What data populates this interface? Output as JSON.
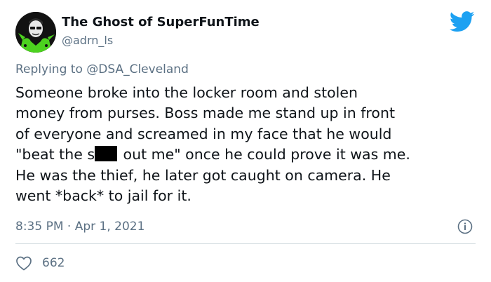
{
  "tweet": {
    "display_name": "The Ghost of SuperFunTime",
    "handle": "@adrn_ls",
    "replying_prefix": "Replying to ",
    "replying_to": "@DSA_Cleveland",
    "body_lines": [
      "Someone broke into the locker room and stolen",
      "money from purses. Boss made me stand up in front",
      "of everyone and screamed in my face that he would",
      "\"beat the s",
      " out me\" once he could prove it was me.",
      "He was the thief, he later got caught on camera. He",
      "went *back* to jail for it."
    ],
    "timestamp": "8:35 PM · Apr 1, 2021",
    "like_count": "662"
  },
  "icons": {
    "brand": "twitter-bird-icon",
    "info": "info-icon",
    "like": "heart-icon"
  },
  "colors": {
    "twitter_blue": "#1da1f2",
    "secondary_text": "#5b7083",
    "avatar_green": "#4cd21f"
  }
}
